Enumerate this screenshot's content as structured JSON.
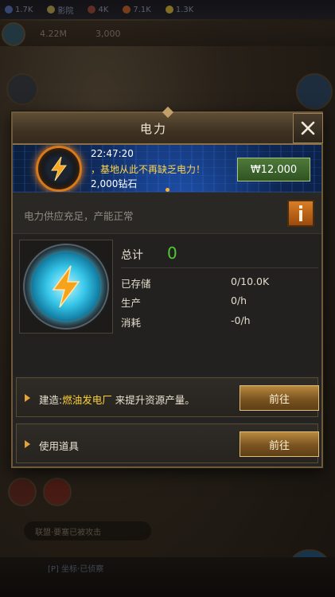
{
  "background": {
    "topbar": [
      "1.7K",
      "影院",
      "4K",
      "7.1K",
      "1.3K"
    ],
    "subbar": [
      "4.22M",
      "3,000"
    ],
    "chat": "联盟·要塞已被攻击",
    "bottom_text": "[P] 坐标·已侦察"
  },
  "dialog": {
    "title": "电力",
    "banner": {
      "time": "22:47:20",
      "message": "，基地从此不再缺乏电力！",
      "reward": "2,000钻石",
      "price": "₩12.000"
    },
    "status": "电力供应充足，产能正常",
    "stats": {
      "total_label": "总计",
      "total_value": "0",
      "rows": [
        {
          "label": "已存储",
          "value": "0/10.0K"
        },
        {
          "label": "生产",
          "value": "0/h"
        },
        {
          "label": "消耗",
          "value": "-0/h"
        }
      ]
    },
    "actions": [
      {
        "prefix": "建造:",
        "highlight": "燃油发电厂",
        "suffix": " 来提升资源产量。",
        "button": "前往"
      },
      {
        "prefix": "使用道具",
        "highlight": "",
        "suffix": "",
        "button": "前往"
      }
    ]
  },
  "colors": {
    "accent_green": "#4ccc2e",
    "highlight_yellow": "#ffd23a",
    "price_button": "#3f6a2e"
  }
}
